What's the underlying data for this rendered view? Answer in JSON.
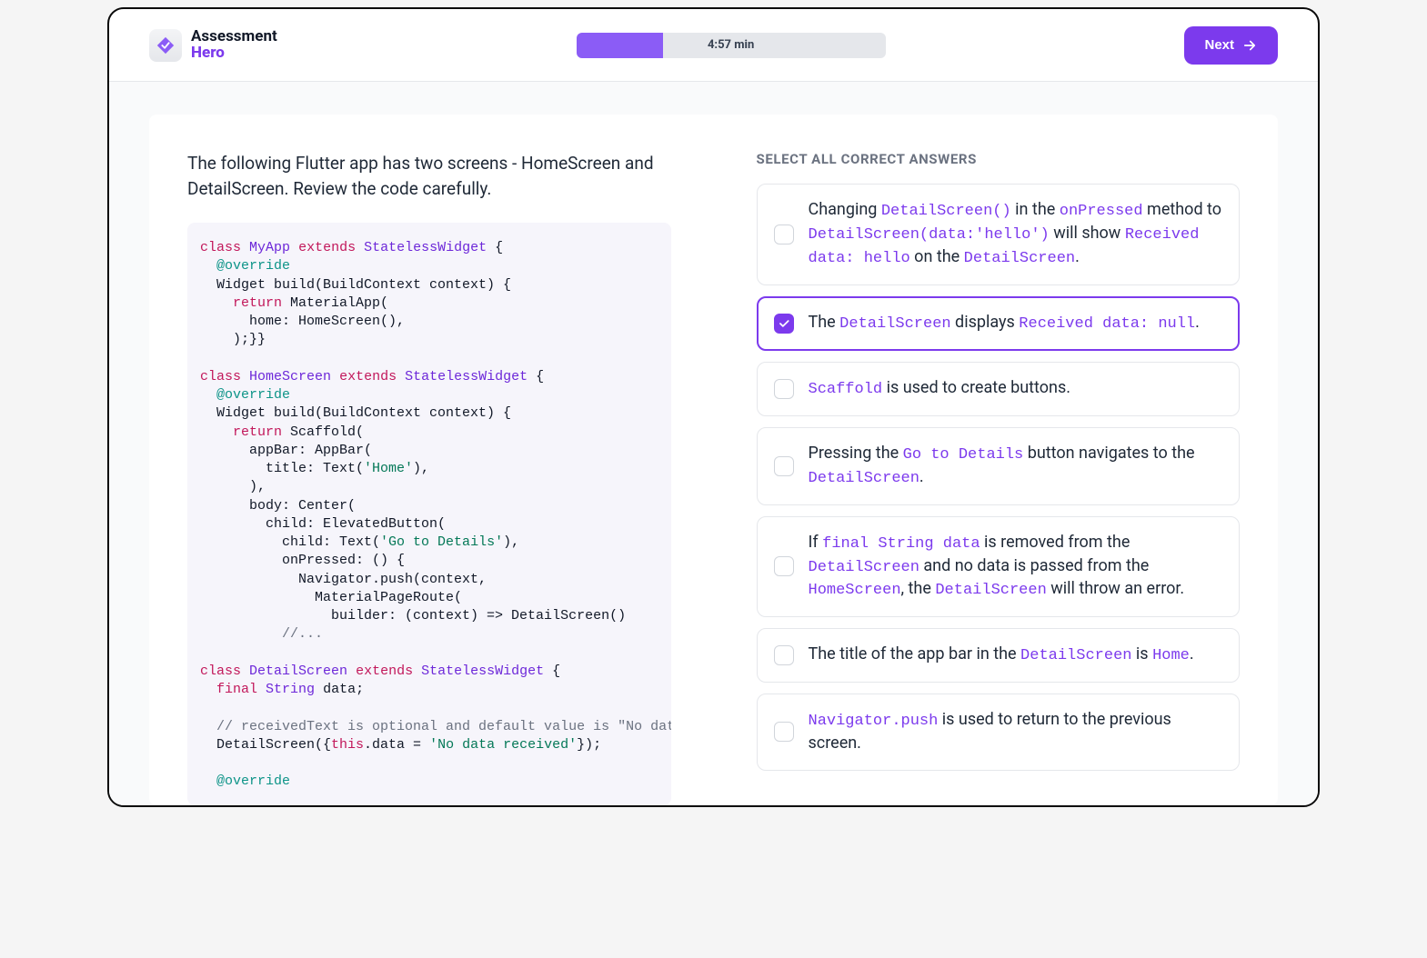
{
  "brand": {
    "line1": "Assessment",
    "line2": "Hero"
  },
  "progress": {
    "percent": 28,
    "label": "4:57 min"
  },
  "next_label": "Next",
  "question": "The following Flutter app has two screens - HomeScreen and DetailScreen. Review the code carefully.",
  "instruction": "SELECT ALL CORRECT ANSWERS",
  "code": {
    "l1a": "class",
    "l1b": "MyApp",
    "l1c": "extends",
    "l1d": "StatelessWidget",
    "l1e": " {",
    "l2a": "  ",
    "l2b": "@override",
    "l3": "  Widget build(BuildContext context) {",
    "l4a": "    ",
    "l4b": "return",
    "l4c": " MaterialApp(",
    "l5": "      home: HomeScreen(),",
    "l6": "    );}}",
    "l7a": "class",
    "l7b": "HomeScreen",
    "l7c": "extends",
    "l7d": "StatelessWidget",
    "l7e": " {",
    "l8a": "  ",
    "l8b": "@override",
    "l9": "  Widget build(BuildContext context) {",
    "l10a": "    ",
    "l10b": "return",
    "l10c": " Scaffold(",
    "l11": "      appBar: AppBar(",
    "l12a": "        title: Text(",
    "l12b": "'Home'",
    "l12c": "),",
    "l13": "      ),",
    "l14": "      body: Center(",
    "l15": "        child: ElevatedButton(",
    "l16a": "          child: Text(",
    "l16b": "'Go to Details'",
    "l16c": "),",
    "l17": "          onPressed: () {",
    "l18": "            Navigator.push(context,",
    "l19": "              MaterialPageRoute(",
    "l20": "                builder: (context) => DetailScreen()",
    "l21": "          //...",
    "l22a": "class",
    "l22b": "DetailScreen",
    "l22c": "extends",
    "l22d": "StatelessWidget",
    "l22e": " {",
    "l23a": "  ",
    "l23b": "final",
    "l23c": "String",
    "l23d": " data;",
    "l24": "  // receivedText is optional and default value is \"No data received\"",
    "l25a": "  DetailScreen({",
    "l25b": "this",
    "l25c": ".data = ",
    "l25d": "'No data received'",
    "l25e": "});",
    "l26a": "  ",
    "l26b": "@override"
  },
  "options": [
    {
      "checked": false,
      "segments": [
        {
          "t": "Changing "
        },
        {
          "t": "DetailScreen()",
          "code": true
        },
        {
          "t": " in the "
        },
        {
          "t": "onPressed",
          "code": true
        },
        {
          "t": " method to "
        },
        {
          "t": "DetailScreen(data:'hello')",
          "code": true
        },
        {
          "t": " will show "
        },
        {
          "t": "Received data: hello",
          "code": true
        },
        {
          "t": " on the "
        },
        {
          "t": "DetailScreen",
          "code": true
        },
        {
          "t": "."
        }
      ]
    },
    {
      "checked": true,
      "segments": [
        {
          "t": "The "
        },
        {
          "t": "DetailScreen",
          "code": true
        },
        {
          "t": " displays "
        },
        {
          "t": "Received data: null",
          "code": true
        },
        {
          "t": "."
        }
      ]
    },
    {
      "checked": false,
      "segments": [
        {
          "t": "Scaffold",
          "code": true
        },
        {
          "t": " is used to create buttons."
        }
      ]
    },
    {
      "checked": false,
      "segments": [
        {
          "t": "Pressing the "
        },
        {
          "t": "Go to Details",
          "code": true
        },
        {
          "t": " button navigates to the "
        },
        {
          "t": "DetailScreen",
          "code": true
        },
        {
          "t": "."
        }
      ]
    },
    {
      "checked": false,
      "segments": [
        {
          "t": "If "
        },
        {
          "t": "final String data",
          "code": true
        },
        {
          "t": " is removed from the "
        },
        {
          "t": "DetailScreen",
          "code": true
        },
        {
          "t": " and no data is passed from the "
        },
        {
          "t": "HomeScreen",
          "code": true
        },
        {
          "t": ", the "
        },
        {
          "t": "DetailScreen",
          "code": true
        },
        {
          "t": " will throw an error."
        }
      ]
    },
    {
      "checked": false,
      "segments": [
        {
          "t": "The title of the app bar in the "
        },
        {
          "t": "DetailScreen",
          "code": true
        },
        {
          "t": " is "
        },
        {
          "t": "Home",
          "code": true
        },
        {
          "t": "."
        }
      ]
    },
    {
      "checked": false,
      "segments": [
        {
          "t": "Navigator.push",
          "code": true
        },
        {
          "t": " is used to return to the previous screen."
        }
      ]
    }
  ]
}
